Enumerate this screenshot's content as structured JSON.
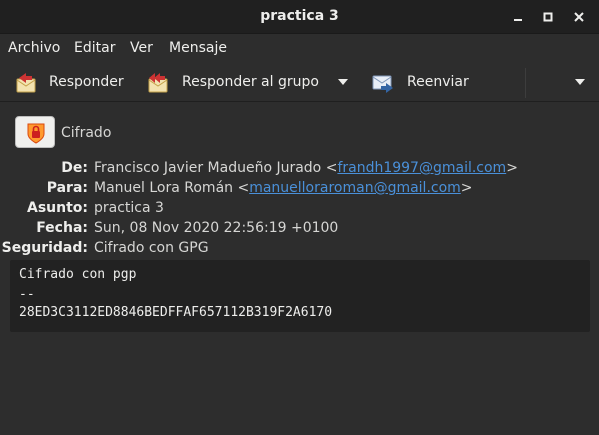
{
  "window": {
    "title": "practica 3"
  },
  "menu": {
    "items": [
      "Archivo",
      "Editar",
      "Ver",
      "Mensaje"
    ]
  },
  "toolbar": {
    "reply_label": "Responder",
    "reply_all_label": "Responder al grupo",
    "forward_label": "Reenviar"
  },
  "security_badge": {
    "label": "Cifrado",
    "icon": "encrypted-shield-icon"
  },
  "headers": {
    "from_label": "De:",
    "from_name": "Francisco Javier Madueño Jurado <",
    "from_email": "frandh1997@gmail.com",
    "from_close": ">",
    "to_label": "Para:",
    "to_name": "Manuel Lora Román <",
    "to_email": "manuelloraroman@gmail.com",
    "to_close": ">",
    "subject_label": "Asunto:",
    "subject": "practica 3",
    "date_label": "Fecha:",
    "date": "Sun, 08 Nov 2020 22:56:19 +0100",
    "security_label": "Seguridad:",
    "security": "Cifrado con GPG"
  },
  "body": {
    "lines": [
      "Cifrado con pgp",
      "--",
      "28ED3C3112ED8846BEDFFAF657112B319F2A6170"
    ]
  },
  "colors": {
    "background": "#2d2d2d",
    "titlebar": "#202020",
    "link": "#4a90d9",
    "body_box": "#222222"
  }
}
